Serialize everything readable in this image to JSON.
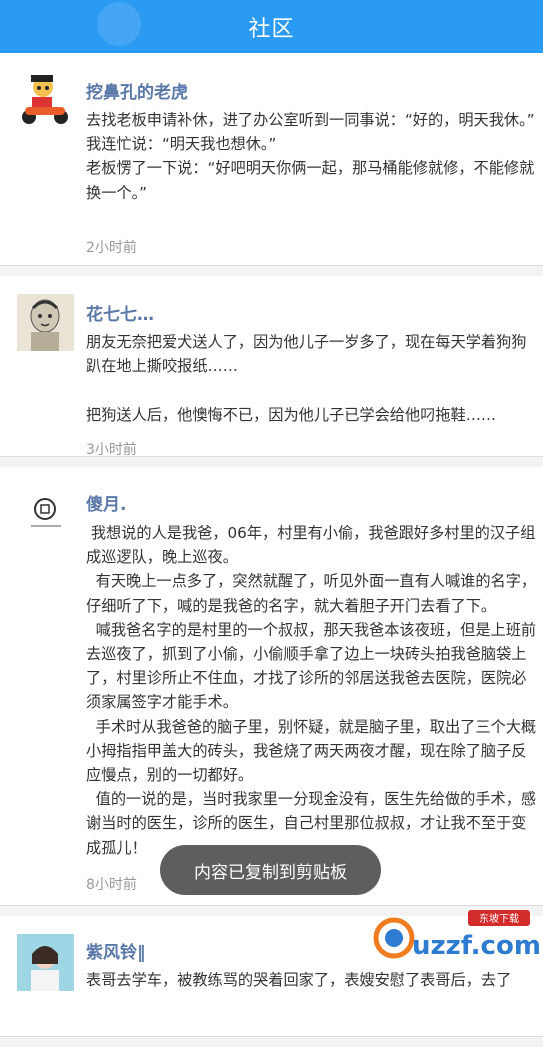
{
  "appbar": {
    "title": "社区"
  },
  "posts": [
    {
      "author": "挖鼻孔的老虎",
      "content": "去找老板申请补休，进了办公室听到一同事说：“好的，明天我休。”\n我连忙说：“明天我也想休。”\n老板愣了一下说：“好吧明天你俩一起，那马桶能修就修，不能修就换一个。”",
      "time": "2小时前"
    },
    {
      "author": "花七七…",
      "content": "朋友无奈把爱犬送人了，因为他儿子一岁多了，现在每天学着狗狗趴在地上撕咬报纸……\n\n把狗送人后，他懊悔不已，因为他儿子已学会给他叼拖鞋……",
      "time": "3小时前"
    },
    {
      "author": "傻月.",
      "content": " 我想说的人是我爸，06年，村里有小偷，我爸跟好多村里的汉子组成巡逻队，晚上巡夜。\n  有天晚上一点多了，突然就醒了，听见外面一直有人喊谁的名字，仔细听了下，喊的是我爸的名字，就大着胆子开门去看了下。\n  喊我爸名字的是村里的一个叔叔，那天我爸本该夜班，但是上班前去巡夜了，抓到了小偷，小偷顺手拿了边上一块砖头拍我爸脑袋上了，村里诊所止不住血，才找了诊所的邻居送我爸去医院，医院必须家属签字才能手术。\n  手术时从我爸爸的脑子里，别怀疑，就是脑子里，取出了三个大概小拇指指甲盖大的砖头，我爸烧了两天两夜才醒，现在除了脑子反应慢点，别的一切都好。\n  值的一说的是，当时我家里一分现金没有，医生先给做的手术，感谢当时的医生，诊所的医生，自己村里那位叔叔，才让我不至于变成孤儿！",
      "time": "8小时前"
    },
    {
      "author": "紫风铃‖",
      "content": "表哥去学车，被教练骂的哭着回家了，表嫂安慰了表哥后，去了",
      "time": ""
    }
  ],
  "toast": {
    "text": "内容已复制到剪贴板"
  },
  "logo": {
    "text": "uzzf.com",
    "badge": "东坡下载"
  }
}
